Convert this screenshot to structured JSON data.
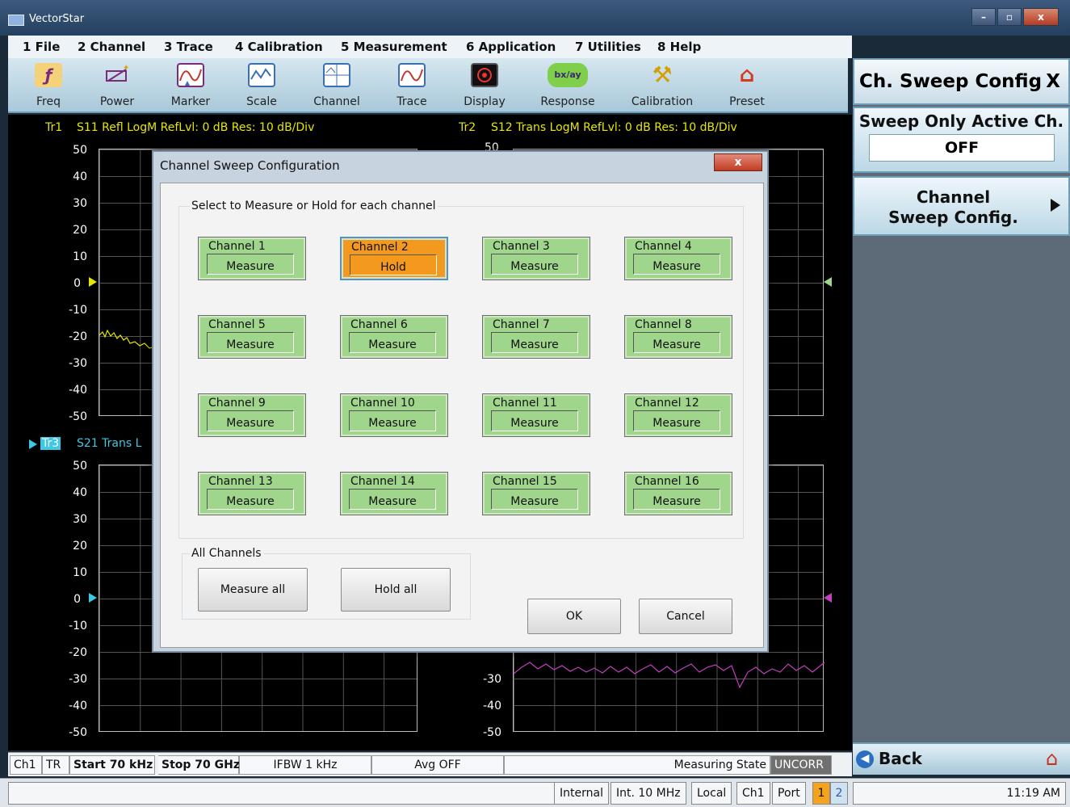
{
  "app": {
    "title": "VectorStar"
  },
  "window_buttons": {
    "minimize": "–",
    "restore": "▫",
    "close": "x"
  },
  "menu": [
    "1 File",
    "2 Channel",
    "3 Trace",
    "4 Calibration",
    "5 Measurement",
    "6 Application",
    "7 Utilities",
    "8 Help"
  ],
  "toolbar": [
    {
      "label": "Freq",
      "icon": "freq-icon"
    },
    {
      "label": "Power",
      "icon": "power-icon"
    },
    {
      "label": "Marker",
      "icon": "marker-icon"
    },
    {
      "label": "Scale",
      "icon": "scale-icon"
    },
    {
      "label": "Channel",
      "icon": "channel-icon"
    },
    {
      "label": "Trace",
      "icon": "trace-icon"
    },
    {
      "label": "Display",
      "icon": "display-icon"
    },
    {
      "label": "Response",
      "icon": "response-icon"
    },
    {
      "label": "Calibration",
      "icon": "calibration-icon"
    },
    {
      "label": "Preset",
      "icon": "preset-icon"
    }
  ],
  "response_icon_text": "bx/ay",
  "traces": {
    "tr1_label": "Tr1",
    "tr1_header": "S11 Refl LogM RefLvl: 0  dB Res: 10  dB/Div",
    "tr2_label": "Tr2",
    "tr2_header": "S12 Trans LogM RefLvl: 0  dB Res: 10  dB/Div",
    "tr2_clipped_tick": "50",
    "tr3_label": "Tr3",
    "tr3_header": "S21 Trans L",
    "y_ticks": [
      "50",
      "40",
      "30",
      "20",
      "10",
      "0",
      "-10",
      "-20",
      "-30",
      "-40",
      "-50"
    ],
    "lower_right_ticks": [
      "-30",
      "-40",
      "-50"
    ]
  },
  "right_panel": {
    "title": "Ch. Sweep Config",
    "close": "X",
    "sweep_only_label": "Sweep Only Active Ch.",
    "sweep_only_value": "OFF",
    "channel_sweep_line1": "Channel",
    "channel_sweep_line2": "Sweep Config.",
    "back": "Back"
  },
  "status": {
    "ch": "Ch1",
    "tr": "TR",
    "start": "Start 70 kHz",
    "stop": "Stop 70 GHz",
    "ifbw": "IFBW 1 kHz",
    "avg": "Avg OFF",
    "measuring": "Measuring State",
    "uncorr": "UNCORR"
  },
  "bottom": {
    "internal": "Internal",
    "ref": "Int. 10 MHz",
    "local": "Local",
    "ch": "Ch1",
    "port": "Port",
    "port1": "1",
    "port2": "2",
    "time": "11:19 AM"
  },
  "dialog": {
    "title": "Channel Sweep Configuration",
    "close": "x",
    "group_label": "Select to Measure or Hold for each channel",
    "channels": [
      {
        "name": "Channel 1",
        "state": "Measure"
      },
      {
        "name": "Channel 2",
        "state": "Hold"
      },
      {
        "name": "Channel 3",
        "state": "Measure"
      },
      {
        "name": "Channel 4",
        "state": "Measure"
      },
      {
        "name": "Channel 5",
        "state": "Measure"
      },
      {
        "name": "Channel 6",
        "state": "Measure"
      },
      {
        "name": "Channel 7",
        "state": "Measure"
      },
      {
        "name": "Channel 8",
        "state": "Measure"
      },
      {
        "name": "Channel 9",
        "state": "Measure"
      },
      {
        "name": "Channel 10",
        "state": "Measure"
      },
      {
        "name": "Channel 11",
        "state": "Measure"
      },
      {
        "name": "Channel 12",
        "state": "Measure"
      },
      {
        "name": "Channel 13",
        "state": "Measure"
      },
      {
        "name": "Channel 14",
        "state": "Measure"
      },
      {
        "name": "Channel 15",
        "state": "Measure"
      },
      {
        "name": "Channel 16",
        "state": "Measure"
      }
    ],
    "all_channels_label": "All Channels",
    "measure_all": "Measure all",
    "hold_all": "Hold all",
    "ok": "OK",
    "cancel": "Cancel"
  },
  "colors": {
    "tr1": "#e6e600",
    "tr3": "#3fc7e6",
    "tr4": "#c040c0",
    "measure_bg": "#9fd68c",
    "hold_bg": "#f39a1e",
    "uncorr_bg": "#6f6f6f"
  }
}
